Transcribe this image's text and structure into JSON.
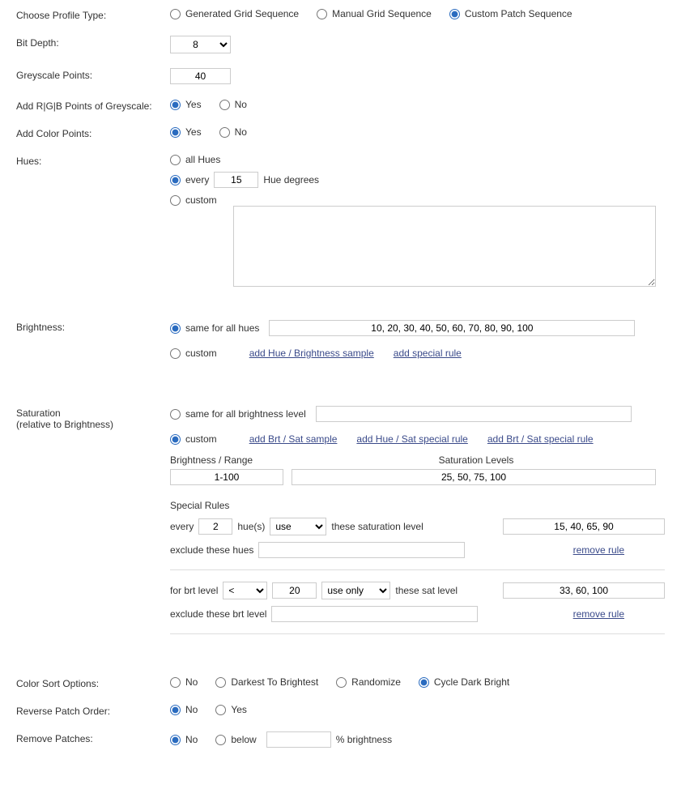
{
  "profileType": {
    "label": "Choose Profile Type:",
    "options": {
      "generated": "Generated Grid Sequence",
      "manual": "Manual Grid Sequence",
      "custom": "Custom Patch Sequence"
    },
    "selected": "custom"
  },
  "bitDepth": {
    "label": "Bit Depth:",
    "value": "8"
  },
  "greyscale": {
    "label": "Greyscale Points:",
    "value": "40"
  },
  "addRGB": {
    "label": "Add R|G|B Points of Greyscale:",
    "yes": "Yes",
    "no": "No"
  },
  "addColor": {
    "label": "Add Color Points:",
    "yes": "Yes",
    "no": "No"
  },
  "hues": {
    "label": "Hues:",
    "all": "all Hues",
    "every": "every",
    "hueDeg": "Hue degrees",
    "hueVal": "15",
    "custom": "custom"
  },
  "brightness": {
    "label": "Brightness:",
    "same": "same for all hues",
    "sameVal": "10, 20, 30, 40, 50, 60, 70, 80, 90, 100",
    "custom": "custom",
    "addSample": "add Hue / Brightness sample",
    "addSpecial": "add special rule"
  },
  "saturation": {
    "label1": "Saturation",
    "label2": "(relative to Brightness)",
    "same": "same for all brightness level",
    "sameVal": "",
    "custom": "custom",
    "addBrtSat": "add Brt / Sat sample",
    "addHueSat": "add Hue / Sat special rule",
    "addBrtSatRule": "add Brt / Sat special rule",
    "header1": "Brightness / Range",
    "header2": "Saturation Levels",
    "brtRange": "1-100",
    "satLevels": "25, 50, 75, 100",
    "specialTitle": "Special Rules",
    "rule1": {
      "every": "every",
      "n": "2",
      "hues": "hue(s)",
      "use": "use",
      "these": "these saturation level",
      "levels": "15, 40, 65, 90",
      "exclude": "exclude these hues",
      "excludeVal": "",
      "remove": "remove rule"
    },
    "rule2": {
      "for": "for brt level",
      "op": "<",
      "n": "20",
      "use": "use only",
      "these": "these sat level",
      "levels": "33, 60, 100",
      "exclude": "exclude these brt level",
      "excludeVal": "",
      "remove": "remove rule"
    }
  },
  "colorSort": {
    "label": "Color Sort Options:",
    "no": "No",
    "dark": "Darkest To Brightest",
    "rand": "Randomize",
    "cycle": "Cycle Dark Bright"
  },
  "reverse": {
    "label": "Reverse Patch Order:",
    "no": "No",
    "yes": "Yes"
  },
  "remove": {
    "label": "Remove Patches:",
    "no": "No",
    "below": "below",
    "pct": "% brightness",
    "pctVal": ""
  }
}
